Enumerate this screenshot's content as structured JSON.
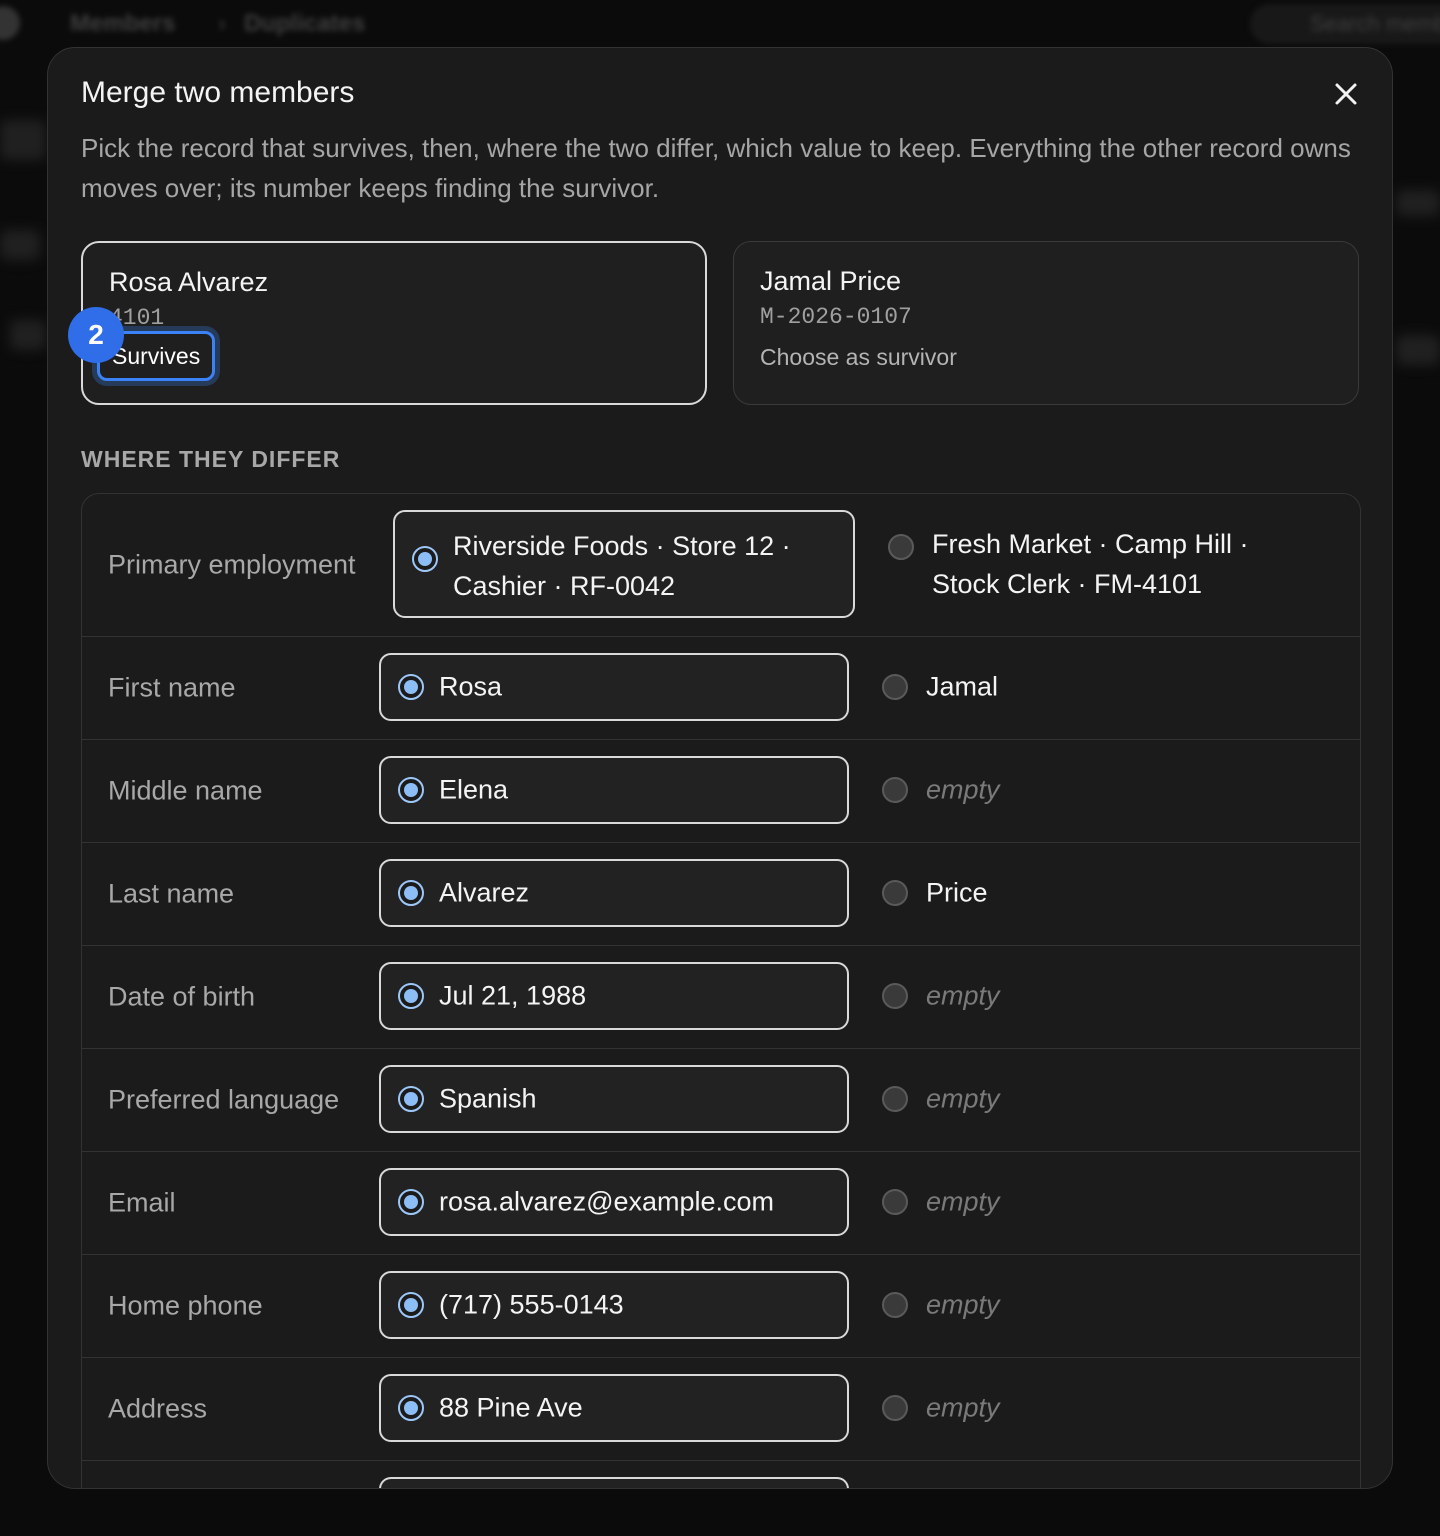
{
  "background": {
    "breadcrumb": [
      "Members",
      "Duplicates"
    ],
    "search_label": "Search members"
  },
  "modal": {
    "title": "Merge two members",
    "description": "Pick the record that survives, then, where the two differ, which value to keep. Everything the other record owns moves over; its number keeps finding the survivor.",
    "close_icon": "close-icon",
    "step_badge": "2",
    "cards": [
      {
        "name": "Rosa Alvarez",
        "member_id": "4101",
        "status": "Survives"
      },
      {
        "name": "Jamal Price",
        "member_id": "M-2026-0107",
        "status": "Choose as survivor"
      }
    ],
    "section_label": "WHERE THEY DIFFER",
    "rows": [
      {
        "label": "Primary employment",
        "a": "Riverside Foods · Store 12 · Cashier · RF-0042",
        "b": "Fresh Market · Camp Hill · Stock Clerk · FM-4101"
      },
      {
        "label": "First name",
        "a": "Rosa",
        "b": "Jamal"
      },
      {
        "label": "Middle name",
        "a": "Elena",
        "b": "empty"
      },
      {
        "label": "Last name",
        "a": "Alvarez",
        "b": "Price"
      },
      {
        "label": "Date of birth",
        "a": "Jul 21, 1988",
        "b": "empty"
      },
      {
        "label": "Preferred language",
        "a": "Spanish",
        "b": "empty"
      },
      {
        "label": "Email",
        "a": "rosa.alvarez@example.com",
        "b": "empty"
      },
      {
        "label": "Home phone",
        "a": "(717) 555-0143",
        "b": "empty"
      },
      {
        "label": "Address",
        "a": "88 Pine Ave",
        "b": "empty"
      }
    ]
  },
  "colors": {
    "accent": "#3b82f6",
    "radio_selected": "#8dbdf5",
    "modal_bg": "#1b1b1b"
  }
}
